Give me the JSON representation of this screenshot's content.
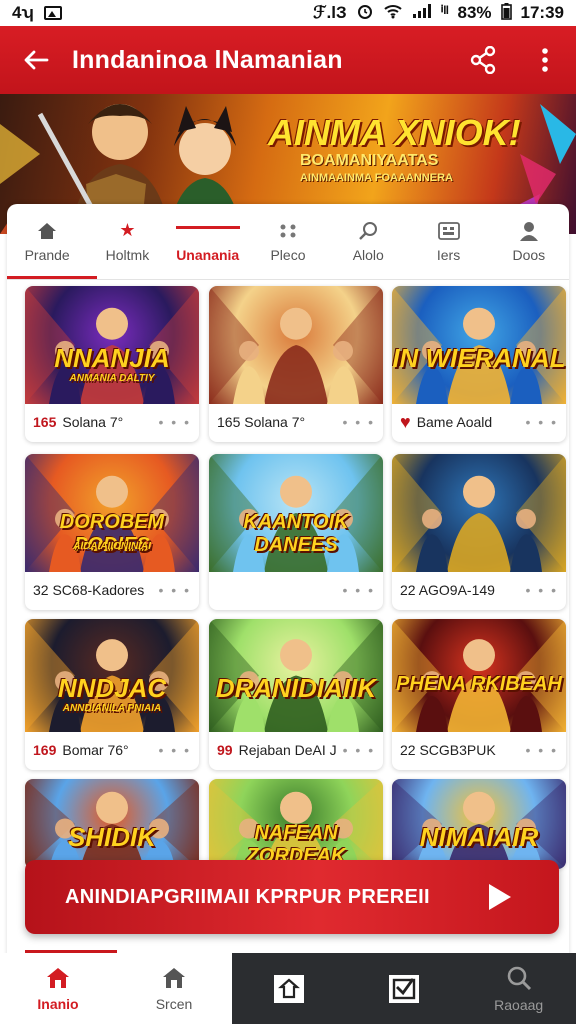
{
  "status_bar": {
    "left_text": "4ʮ",
    "carrier": "ℱ.lЗ",
    "signal_label": "ⁱˡˡ",
    "battery_percent": "83%",
    "time": "17:39"
  },
  "appbar": {
    "title": "Inndaninoa lNamanian",
    "back_icon": "arrow-left-icon",
    "share_icon": "share-icon",
    "more_icon": "more-vertical-icon"
  },
  "banner": {
    "title": "AINMA XNIOK!",
    "subtitle": "BOAMANIYAATAS",
    "tagline": "AINMAAINMA FOAAANNERA"
  },
  "tabs": [
    {
      "label": "Prande",
      "icon": "home-icon"
    },
    {
      "label": "Holtmk",
      "icon": "star-icon"
    },
    {
      "label": "Unanania",
      "icon": "flame-icon"
    },
    {
      "label": "Pleco",
      "icon": "gamepad-icon"
    },
    {
      "label": "Alolo",
      "icon": "search-icon"
    },
    {
      "label": "Iers",
      "icon": "grid-icon"
    },
    {
      "label": "Doos",
      "icon": "person-icon"
    }
  ],
  "games": [
    {
      "art_title": "NNANJIA",
      "art_sub": "ANMANIA DALTIY",
      "num": "165",
      "caption": "Solana 7°",
      "colors": [
        "#2a1a5e",
        "#7b2cbf",
        "#c43b3b"
      ]
    },
    {
      "art_title": "",
      "art_sub": "",
      "num": "",
      "caption": "165 Solana 7°",
      "colors": [
        "#f4d28a",
        "#d9793a",
        "#8b2c1c"
      ]
    },
    {
      "art_title": "IN WIERANAL",
      "art_sub": "",
      "num": "",
      "caption": "Bame Aoald",
      "heart": true,
      "colors": [
        "#1b5fbf",
        "#41a6e6",
        "#f2b233"
      ]
    },
    {
      "art_title": "DOROBEM PODIES",
      "art_sub": "AIDAIAIIONINIAI",
      "num": "",
      "caption": "32 SC68-Kadores",
      "colors": [
        "#e65a22",
        "#f2a12b",
        "#3a2a6e"
      ]
    },
    {
      "art_title": "KAANTOIK DANEES",
      "art_sub": "",
      "num": "",
      "caption": "",
      "colors": [
        "#6fc3ef",
        "#b8e4f5",
        "#3b6e2a"
      ]
    },
    {
      "art_title": "",
      "art_sub": "",
      "num": "",
      "caption": "22 AGO9A-149",
      "colors": [
        "#18345f",
        "#2f76b8",
        "#d9a623"
      ]
    },
    {
      "art_title": "NNDJAC",
      "art_sub": "ANNDIANILA PNIAIA",
      "num": "169",
      "caption": "Bomar 76°",
      "colors": [
        "#1c1c2e",
        "#5a2a22",
        "#f2a12b"
      ]
    },
    {
      "art_title": "DRANIDIAIIK",
      "art_sub": "",
      "num": "",
      "caption": "Rejaban DeAI J",
      "heart_num": "99",
      "colors": [
        "#9fe06a",
        "#e9f2a0",
        "#2f5e1f"
      ]
    },
    {
      "art_title": "PHENA RKIBEAH",
      "art_sub": "",
      "num": "",
      "caption": "22 SCGB3PUK",
      "colors": [
        "#5a0f0f",
        "#d9341f",
        "#f2b233"
      ]
    },
    {
      "art_title": "SHIDIK",
      "art_sub": "",
      "num": "",
      "caption": "",
      "colors": [
        "#5aa4e8",
        "#e65a22",
        "#7b2c1c"
      ]
    },
    {
      "art_title": "NAFEAN ZORDEAK",
      "art_sub": "",
      "num": "",
      "caption": "",
      "colors": [
        "#8fd45a",
        "#3a7a2a",
        "#e0c43b"
      ]
    },
    {
      "art_title": "NIMAIAIR",
      "art_sub": "",
      "num": "",
      "caption": "",
      "colors": [
        "#6fb4f0",
        "#f2c23b",
        "#3a2a6e"
      ]
    }
  ],
  "cta": {
    "label": "ANINDIAPGRIIMAII KPRPUR PREREII",
    "icon": "play-icon"
  },
  "bottom_nav": [
    {
      "label": "Inanio",
      "icon": "home-icon"
    },
    {
      "label": "Srcen",
      "icon": "home-outline-icon"
    },
    {
      "label": "",
      "icon": "share-box-icon"
    },
    {
      "label": "",
      "icon": "checkbox-icon"
    },
    {
      "label": "Raoaag",
      "icon": "search-icon"
    }
  ],
  "colors": {
    "accent": "#d31c22",
    "appbar": "#c2141b",
    "dark_nav": "#2b2d30"
  }
}
